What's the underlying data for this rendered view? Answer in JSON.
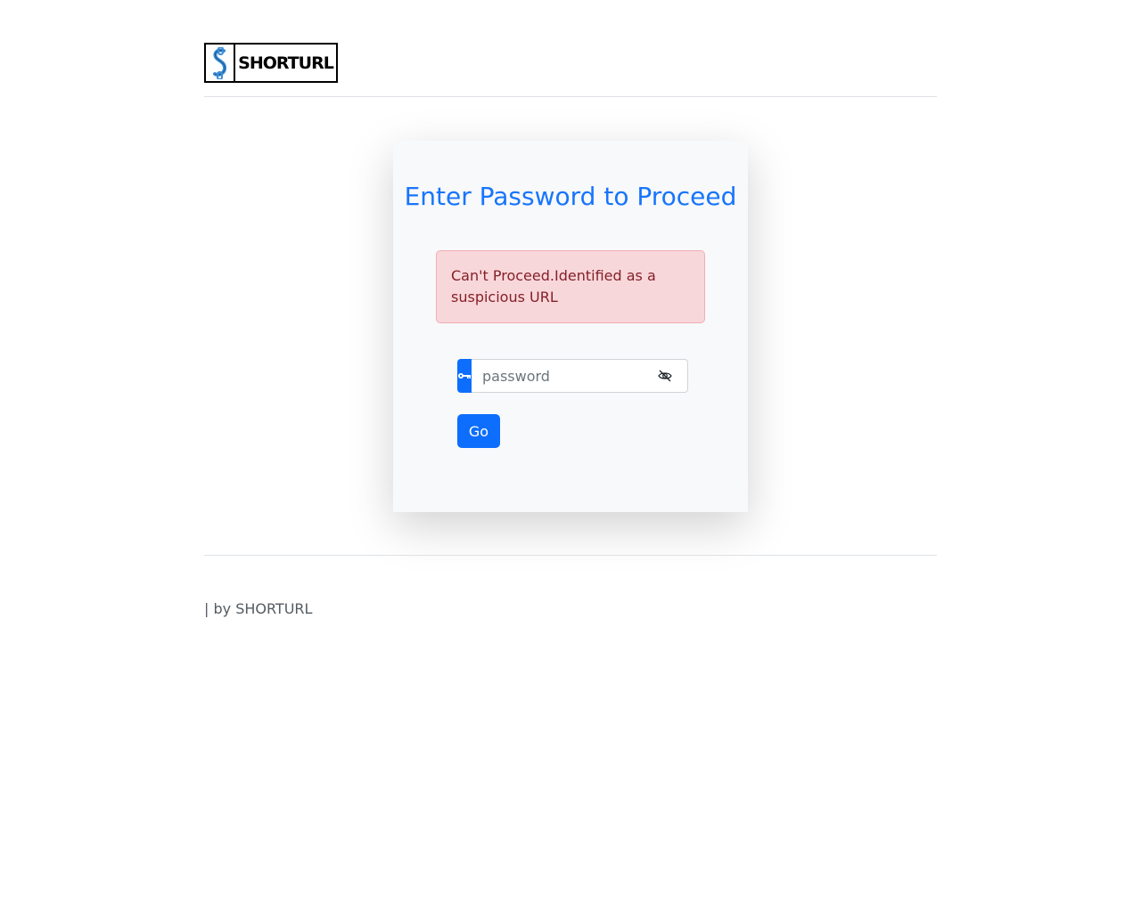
{
  "header": {
    "logo_text": "SHORTURL",
    "logo_icon": "link-s-icon"
  },
  "card": {
    "title": "Enter Password to Proceed",
    "alert_message": "Can't Proceed.Identified as a suspicious URL",
    "password_placeholder": "password",
    "password_value": "",
    "key_icon": "key-icon",
    "toggle_icon": "eye-slash-icon",
    "submit_label": "Go"
  },
  "footer": {
    "text": "| by SHORTURL"
  },
  "colors": {
    "primary": "#0d6efd",
    "alert_bg": "#f8d7da",
    "alert_text": "#842029",
    "card_bg": "#f8f9fa"
  }
}
